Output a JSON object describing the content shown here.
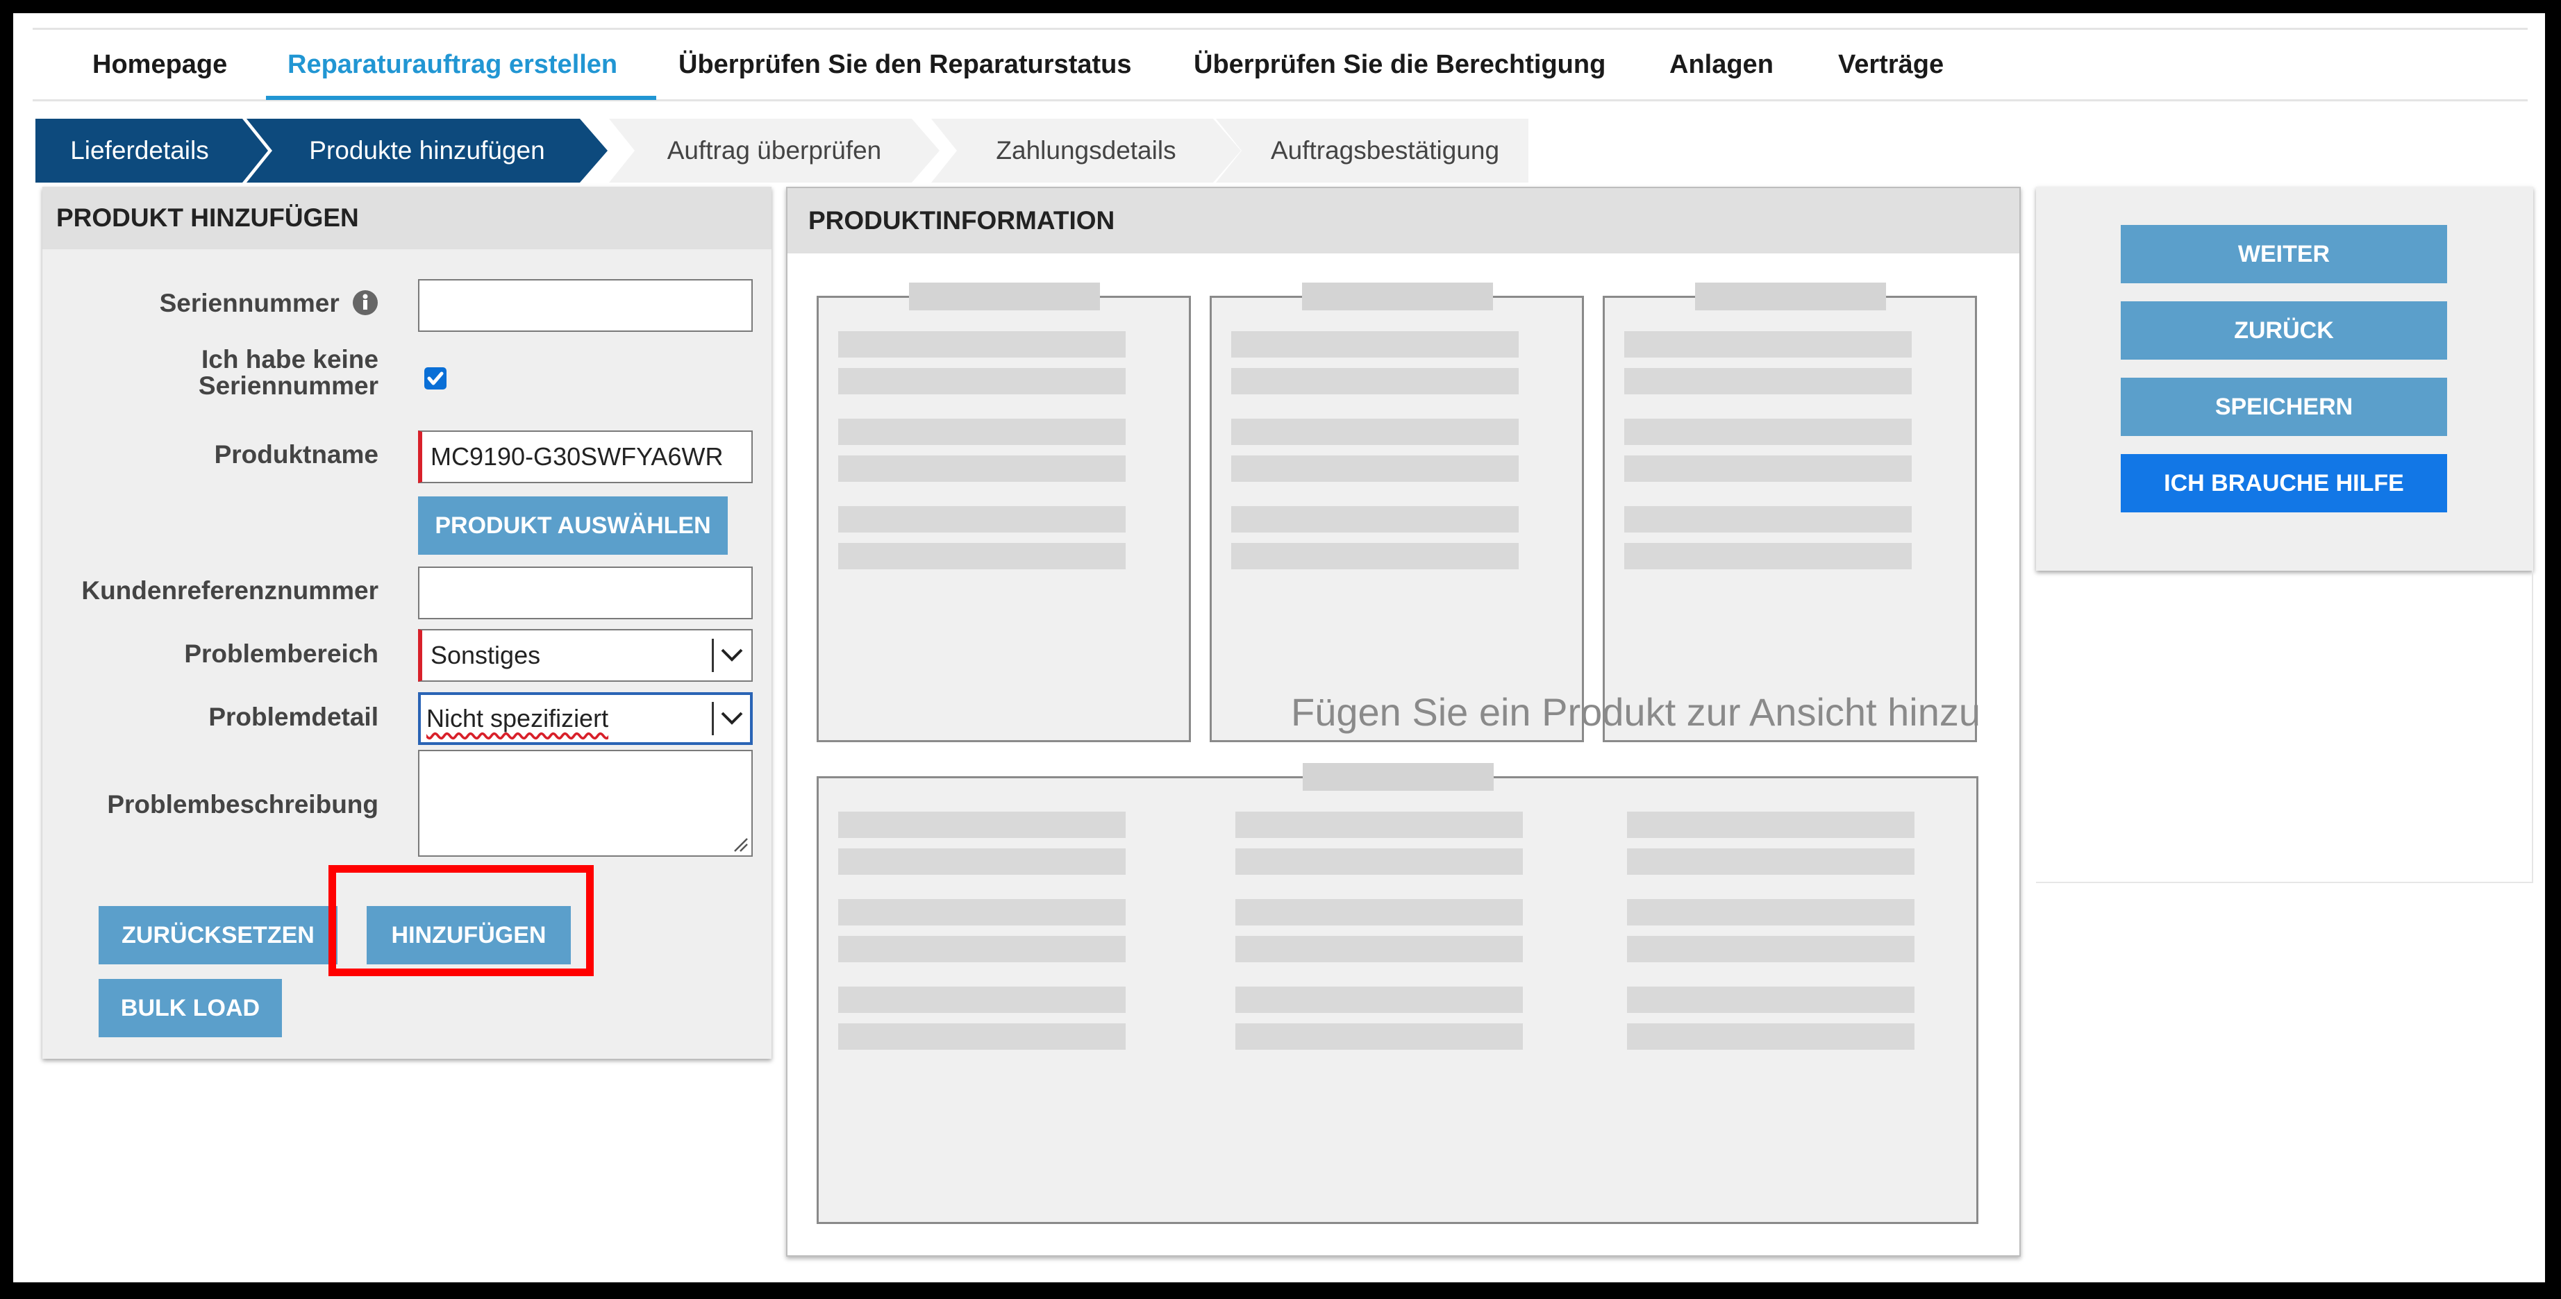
{
  "nav": {
    "items": [
      "Homepage",
      "Reparaturauftrag erstellen",
      "Überprüfen Sie den Reparaturstatus",
      "Überprüfen Sie die Berechtigung",
      "Anlagen",
      "Verträge"
    ],
    "active_index": 1
  },
  "stepper": {
    "steps": [
      "Lieferdetails",
      "Produkte hinzufügen",
      "Auftrag überprüfen",
      "Zahlungsdetails",
      "Auftragsbestätigung"
    ],
    "completed_count": 2
  },
  "add_product": {
    "header": "PRODUKT HINZUFÜGEN",
    "serial_label": "Seriennummer",
    "serial_value": "",
    "no_serial_label_line1": "Ich habe keine",
    "no_serial_label_line2": "Seriennummer",
    "no_serial_checked": true,
    "product_name_label": "Produktname",
    "product_name_value": "MC9190-G30SWFYA6WR",
    "select_product_button": "PRODUKT AUSWÄHLEN",
    "customer_ref_label": "Kundenreferenznummer",
    "customer_ref_value": "",
    "problem_area_label": "Problembereich",
    "problem_area_value": "Sonstiges",
    "problem_detail_label": "Problemdetail",
    "problem_detail_value": "Nicht spezifiziert",
    "problem_desc_label": "Problembeschreibung",
    "problem_desc_value": "",
    "reset_button": "ZURÜCKSETZEN",
    "add_button": "HINZUFÜGEN",
    "bulk_button": "BULK LOAD"
  },
  "product_info": {
    "header": "PRODUKTINFORMATION",
    "empty_message": "Fügen Sie ein Produkt zur Ansicht hinzu"
  },
  "actions": {
    "next": "WEITER",
    "back": "ZURÜCK",
    "save": "SPEICHERN",
    "help": "ICH BRAUCHE HILFE"
  },
  "colors": {
    "accent": "#2196d3",
    "stepper_done": "#0d4a7d",
    "button": "#5b9fcb",
    "help_button": "#1277e6",
    "required_marker": "#d8202a",
    "highlight": "#ff0000"
  }
}
